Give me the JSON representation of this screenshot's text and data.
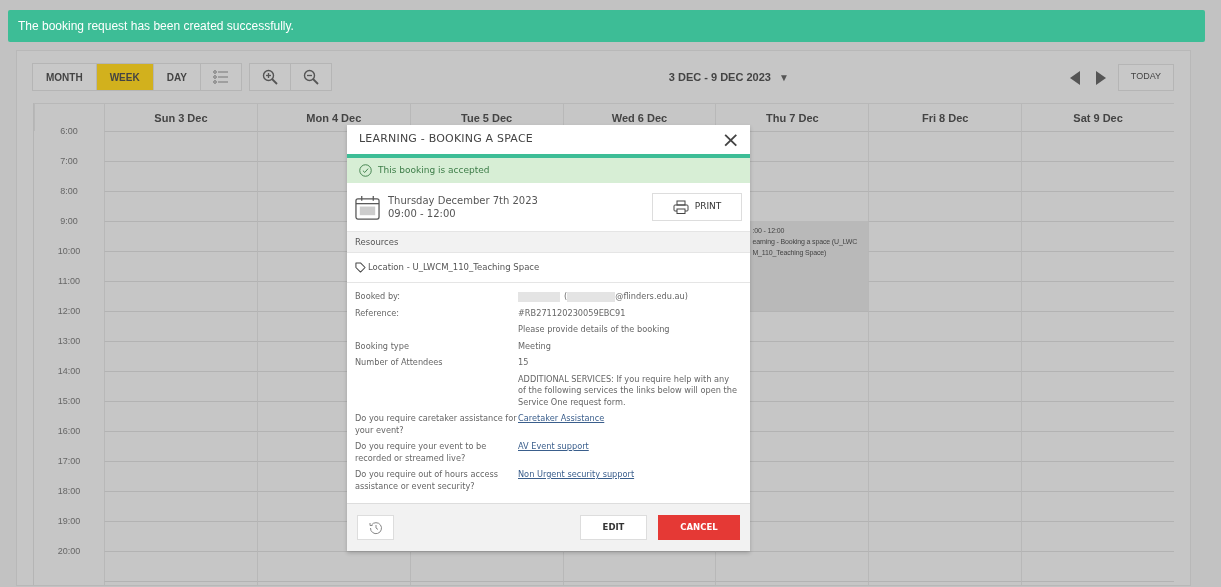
{
  "alert": {
    "message": "The booking request has been created successfully."
  },
  "toolbar": {
    "views": [
      {
        "label": "MONTH",
        "selected": false
      },
      {
        "label": "WEEK",
        "selected": true
      },
      {
        "label": "DAY",
        "selected": false
      }
    ],
    "date_range": "3 DEC - 9 DEC 2023",
    "date_range_caret": "▼",
    "today": "TODAY"
  },
  "calendar": {
    "days": [
      {
        "label": "Sun 3 Dec"
      },
      {
        "label": "Mon 4 Dec"
      },
      {
        "label": "Tue 5 Dec"
      },
      {
        "label": "Wed 6 Dec"
      },
      {
        "label": "Thu 7 Dec",
        "events": [
          {
            "lines": [
              ":00 - 12:00",
              "earning - Booking a space (U_LWC",
              "M_110_Teaching Space)"
            ]
          }
        ]
      },
      {
        "label": "Fri 8 Dec"
      },
      {
        "label": "Sat 9 Dec"
      }
    ],
    "hours": [
      "6:00",
      "7:00",
      "8:00",
      "9:00",
      "10:00",
      "11:00",
      "12:00",
      "13:00",
      "14:00",
      "15:00",
      "16:00",
      "17:00",
      "18:00",
      "19:00",
      "20:00"
    ]
  },
  "modal": {
    "title": "LEARNING - BOOKING A SPACE",
    "close": "×",
    "status": "This booking is accepted",
    "date": "Thursday December 7th 2023",
    "time": "09:00 - 12:00",
    "print": "PRINT",
    "resources_heading": "Resources",
    "location": "Location - U_LWCM_110_Teaching Space",
    "details": [
      {
        "label": "Booked by:",
        "kind": "booked_by",
        "value_parts": [
          "(",
          "@flinders.edu.au)"
        ]
      },
      {
        "label": "Reference:",
        "kind": "text",
        "value": "#RB271120230059EBC91"
      },
      {
        "kind": "text",
        "value": "Please provide details of the booking"
      },
      {
        "label": "Booking type",
        "kind": "text",
        "value": "Meeting"
      },
      {
        "label": "Number of Attendees",
        "kind": "text",
        "value": "15"
      },
      {
        "kind": "text",
        "value": "ADDITIONAL SERVICES: If you require help with any of the following services the links below will open the Service One request form."
      },
      {
        "label": "Do you require caretaker assistance for your event?",
        "kind": "link",
        "value": "Caretaker Assistance"
      },
      {
        "label": "Do you require your event to be recorded or streamed live?",
        "kind": "link",
        "value": "AV Event support"
      },
      {
        "label": "Do you require out of hours access assistance or event security?",
        "kind": "link",
        "value": "Non Urgent security support"
      }
    ],
    "buttons": {
      "edit": "EDIT",
      "cancel": "CANCEL"
    }
  }
}
